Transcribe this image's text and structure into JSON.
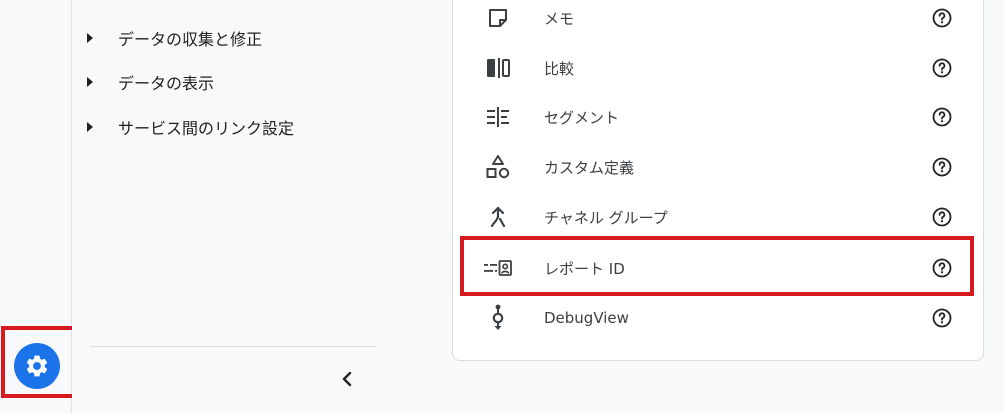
{
  "nav": {
    "items": [
      {
        "label": "データの収集と修正"
      },
      {
        "label": "データの表示"
      },
      {
        "label": "サービス間のリンク設定"
      }
    ]
  },
  "card": {
    "rows": [
      {
        "label": "メモ",
        "icon": "note-icon"
      },
      {
        "label": "比較",
        "icon": "compare-icon"
      },
      {
        "label": "セグメント",
        "icon": "segment-icon"
      },
      {
        "label": "カスタム定義",
        "icon": "custom-definitions-icon"
      },
      {
        "label": "チャネル グループ",
        "icon": "channel-group-icon"
      },
      {
        "label": "レポート ID",
        "icon": "report-id-icon"
      },
      {
        "label": "DebugView",
        "icon": "debug-view-icon"
      }
    ]
  },
  "colors": {
    "accent": "#1a73e8",
    "highlight": "#d71920"
  }
}
